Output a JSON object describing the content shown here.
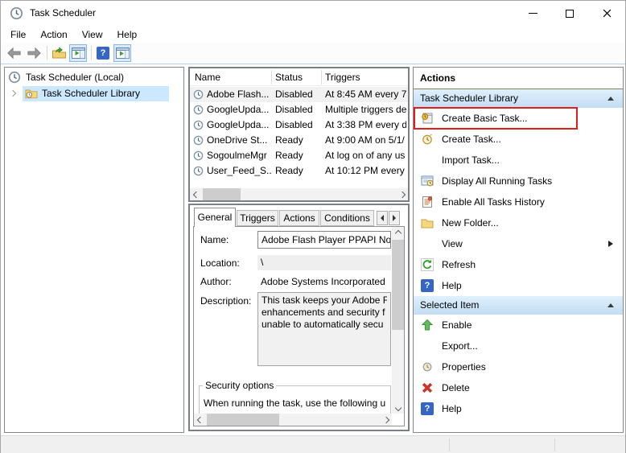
{
  "window": {
    "title": "Task Scheduler"
  },
  "icons": {
    "help_glyph": "?"
  },
  "menu": {
    "items": [
      "File",
      "Action",
      "View",
      "Help"
    ]
  },
  "tree": {
    "root": {
      "label": "Task Scheduler (Local)"
    },
    "child": {
      "label": "Task Scheduler Library",
      "selected": true
    }
  },
  "task_list": {
    "columns": [
      "Name",
      "Status",
      "Triggers"
    ],
    "rows": [
      {
        "name": "Adobe Flash...",
        "status": "Disabled",
        "triggers": "At 8:45 AM every 7"
      },
      {
        "name": "GoogleUpda...",
        "status": "Disabled",
        "triggers": "Multiple triggers de"
      },
      {
        "name": "GoogleUpda...",
        "status": "Disabled",
        "triggers": "At 3:38 PM every da"
      },
      {
        "name": "OneDrive St...",
        "status": "Ready",
        "triggers": "At 9:00 AM on 5/1/"
      },
      {
        "name": "SogoulmeMgr",
        "status": "Ready",
        "triggers": "At log on of any us"
      },
      {
        "name": "User_Feed_S...",
        "status": "Ready",
        "triggers": "At 10:12 PM every d"
      }
    ]
  },
  "details": {
    "tabs": [
      "General",
      "Triggers",
      "Actions",
      "Conditions"
    ],
    "fields": {
      "name_label": "Name:",
      "name_value": "Adobe Flash Player PPAPI Not",
      "location_label": "Location:",
      "location_value": "\\",
      "author_label": "Author:",
      "author_value": "Adobe Systems Incorporated",
      "description_label": "Description:",
      "description_lines": [
        "This task keeps your Adobe F",
        "enhancements and security f",
        "unable to automatically secu"
      ]
    },
    "security": {
      "legend": "Security options",
      "text": "When running the task, use the following u"
    }
  },
  "actions_pane": {
    "title": "Actions",
    "groups": [
      {
        "header": "Task Scheduler Library",
        "items": [
          {
            "label": "Create Basic Task...",
            "icon": "create-basic-task-icon",
            "highlighted": true
          },
          {
            "label": "Create Task...",
            "icon": "create-task-icon"
          },
          {
            "label": "Import Task...",
            "icon": "none"
          },
          {
            "label": "Display All Running Tasks",
            "icon": "display-running-tasks-icon"
          },
          {
            "label": "Enable All Tasks History",
            "icon": "tasks-history-icon"
          },
          {
            "label": "New Folder...",
            "icon": "new-folder-icon"
          },
          {
            "label": "View",
            "icon": "none",
            "submenu": true
          },
          {
            "label": "Refresh",
            "icon": "refresh-icon"
          },
          {
            "label": "Help",
            "icon": "help-icon"
          }
        ]
      },
      {
        "header": "Selected Item",
        "items": [
          {
            "label": "Enable",
            "icon": "enable-icon"
          },
          {
            "label": "Export...",
            "icon": "none"
          },
          {
            "label": "Properties",
            "icon": "properties-icon"
          },
          {
            "label": "Delete",
            "icon": "delete-icon"
          },
          {
            "label": "Help",
            "icon": "help-icon"
          }
        ]
      }
    ],
    "highlight_color": "#e11d1d"
  },
  "colors": {
    "selection_blue": "#cce8ff",
    "group_header_blue": "#cfe2f5",
    "panel_border": "#828790",
    "highlight_box_red": "#e11d1d"
  }
}
